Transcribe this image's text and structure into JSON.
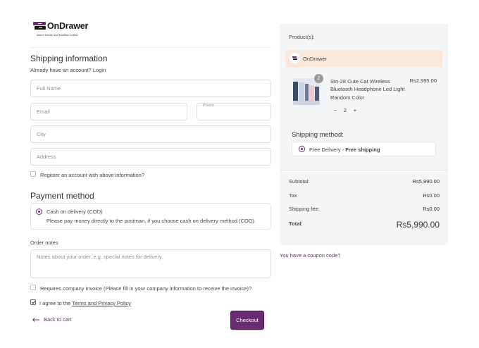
{
  "brand": {
    "name": "OnDrawer",
    "tagline": "where trendy and tradition collide",
    "accent": "#6a2c70"
  },
  "shipping": {
    "title": "Shipping information",
    "account_prompt": "Already have an account?",
    "login_label": "Login",
    "full_name_placeholder": "Full Name",
    "email_placeholder": "Email",
    "phone_label": "Phone",
    "city_placeholder": "City",
    "address_placeholder": "Address",
    "register_label": "Register an account with above information?"
  },
  "payment": {
    "title": "Payment method",
    "method_label": "Cash on delivery (COD)",
    "method_description": "Please pay money directly to the postman, if you choose cash on delivery method (COD).",
    "selected": true
  },
  "notes": {
    "label": "Order notes",
    "placeholder": "Notes about your order, e.g. special notes for delivery."
  },
  "invoice": {
    "label": "Requires company invoice (Please fill in your company information to receive the invoice)?",
    "checked": false
  },
  "terms": {
    "prefix": "I agree to the",
    "link": "Terms and Privacy Policy",
    "checked": true
  },
  "actions": {
    "back_label": "Back to cart",
    "checkout_label": "Checkout"
  },
  "cart": {
    "products_label": "Product(s):",
    "store_name": "OnDrawer",
    "item": {
      "name": "Stn-28 Cute Cat Wireless Bluetooth Headphone Led Light Random Color",
      "price": "Rs2,995.00",
      "quantity": "2",
      "minus": "−",
      "plus": "+"
    },
    "shipping_method_label": "Shipping method:",
    "shipping_option": "Free Delivery",
    "shipping_option_separator": " - ",
    "shipping_option_detail": "Free shipping",
    "subtotal_label": "Subtotal:",
    "subtotal_value": "Rs5,990.00",
    "tax_label": "Tax",
    "tax_value": "Rs0.00",
    "shipping_fee_label": "Shipping fee:",
    "shipping_fee_value": "Rs0.00",
    "total_label": "Total:",
    "total_value": "Rs5,990.00",
    "coupon_label": "You have a coupon code?"
  }
}
